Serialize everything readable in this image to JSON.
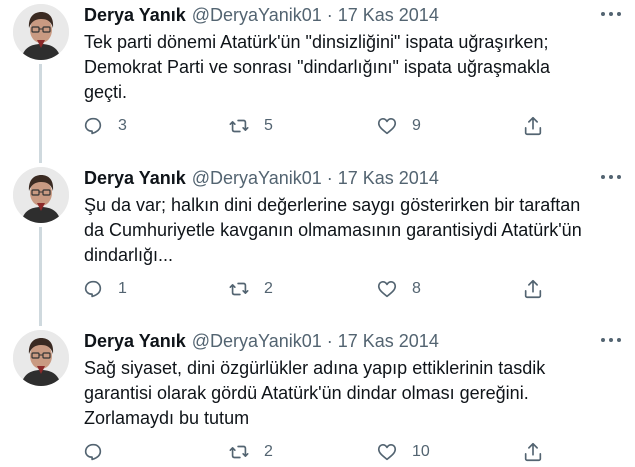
{
  "tweets": [
    {
      "display_name": "Derya Yanık",
      "handle": "@DeryaYanik01",
      "separator": "·",
      "date": "17 Kas 2014",
      "text_lines": [
        "Tek parti dönemi Atatürk'ün \"dinsizliğini\" ispata uğraşırken;",
        "Demokrat Parti ve sonrası \"dindarlığını\" ispata uğraşmakla",
        "geçti."
      ],
      "replies": "3",
      "retweets": "5",
      "likes": "9"
    },
    {
      "display_name": "Derya Yanık",
      "handle": "@DeryaYanik01",
      "separator": "·",
      "date": "17 Kas 2014",
      "text_lines": [
        "Şu da var; halkın dini değerlerine saygı gösterirken bir taraftan",
        "da Cumhuriyetle kavganın olmamasının garantisiydi Atatürk'ün",
        "dindarlığı..."
      ],
      "replies": "1",
      "retweets": "2",
      "likes": "8"
    },
    {
      "display_name": "Derya Yanık",
      "handle": "@DeryaYanik01",
      "separator": "·",
      "date": "17 Kas 2014",
      "text_lines": [
        "Sağ siyaset, dini özgürlükler adına yapıp ettiklerinin tasdik",
        "garantisi olarak gördü Atatürk'ün dindar olması gereğini.",
        "Zorlamaydı bu tutum"
      ],
      "replies": "",
      "retweets": "2",
      "likes": "10"
    }
  ],
  "icons": {
    "reply": "reply-icon",
    "retweet": "retweet-icon",
    "like": "heart-icon",
    "share": "share-icon",
    "more": "more-icon"
  },
  "colors": {
    "text": "#0f1419",
    "secondary": "#536471",
    "thread_line": "#cfd9de"
  }
}
